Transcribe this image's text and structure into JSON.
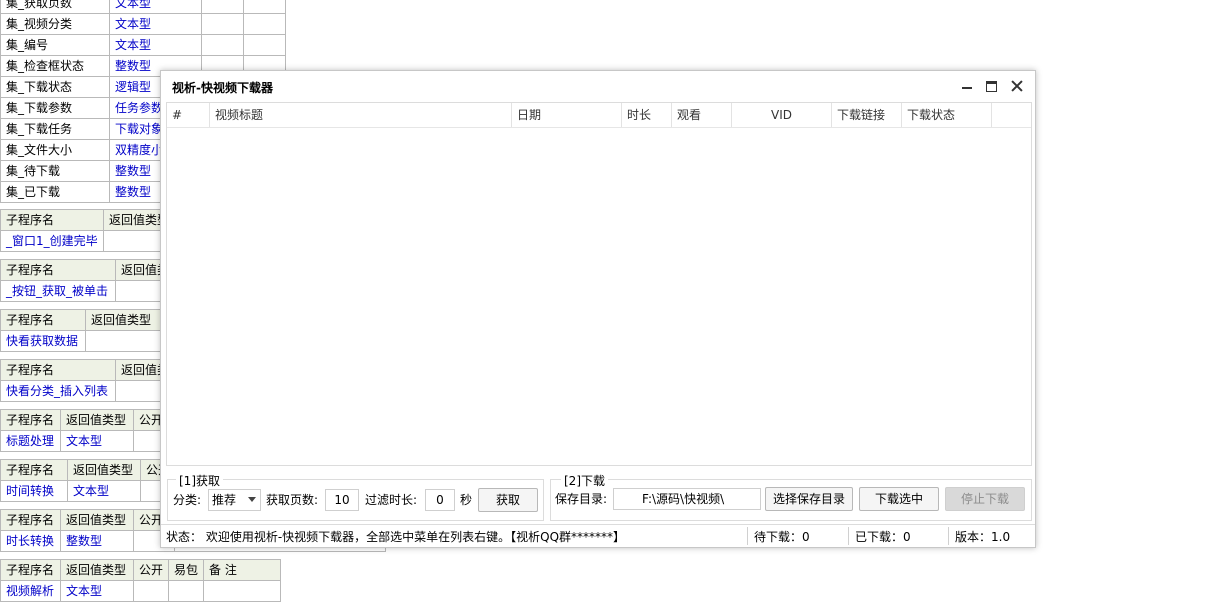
{
  "background": {
    "type_table": [
      {
        "name": "集_获取页数",
        "type": "文本型"
      },
      {
        "name": "集_视频分类",
        "type": "文本型"
      },
      {
        "name": "集_编号",
        "type": "文本型"
      },
      {
        "name": "集_检查框状态",
        "type": "整数型"
      },
      {
        "name": "集_下载状态",
        "type": "逻辑型"
      },
      {
        "name": "集_下载参数",
        "type": "任务参数"
      },
      {
        "name": "集_下载任务",
        "type": "下载对象"
      },
      {
        "name": "集_文件大小",
        "type": "双精度小数型"
      },
      {
        "name": "集_待下载",
        "type": "整数型"
      },
      {
        "name": "集_已下载",
        "type": "整数型"
      }
    ],
    "header_labels": {
      "sub_name": "子程序名",
      "return_type": "返回值类型",
      "public": "公开",
      "easy_pack": "易包",
      "remark": "备 注"
    },
    "subs": [
      {
        "name": "_窗口1_创建完毕",
        "type": ""
      },
      {
        "name": "_按钮_获取_被单击",
        "type": ""
      },
      {
        "name": "快看获取数据",
        "type": ""
      },
      {
        "name": "快看分类_插入列表",
        "type": ""
      },
      {
        "name": "标题处理",
        "type": "文本型"
      },
      {
        "name": "时间转换",
        "type": "文本型"
      },
      {
        "name": "时长转换",
        "type": "整数型"
      },
      {
        "name": "视频解析",
        "type": "文本型"
      }
    ]
  },
  "window": {
    "title": "视析-快视频下载器",
    "columns": [
      "#",
      "视频标题",
      "日期",
      "时长",
      "观看",
      "VID",
      "下载链接",
      "下载状态"
    ],
    "fetch_group": {
      "title": "[1]获取",
      "category_label": "分类:",
      "category_value": "推荐",
      "pages_label": "获取页数:",
      "pages_value": "10",
      "filter_label": "过滤时长:",
      "filter_value": "0",
      "filter_unit": "秒",
      "fetch_button": "获取"
    },
    "download_group": {
      "title": "[2]下载",
      "save_dir_label": "保存目录:",
      "save_dir_value": "F:\\源码\\快视频\\",
      "choose_dir_button": "选择保存目录",
      "download_selected_button": "下载选中",
      "stop_download_button": "停止下载"
    },
    "status": {
      "message": "状态： 欢迎使用视析-快视频下载器，全部选中菜单在列表右键。【视析QQ群*******】",
      "pending": "待下载：0",
      "downloaded": "已下载：0",
      "version": "版本：1.0"
    }
  }
}
